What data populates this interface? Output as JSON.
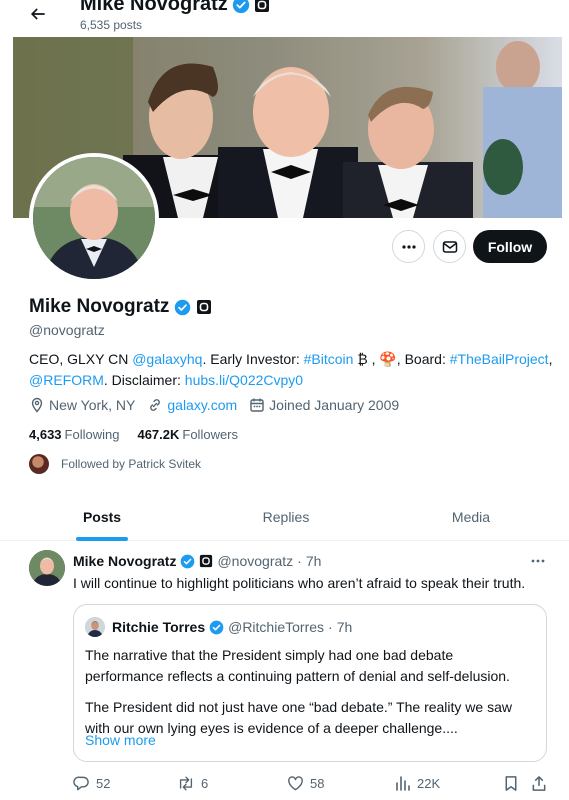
{
  "header": {
    "name": "Mike Novogratz",
    "posts_count": "6,535 posts"
  },
  "profile": {
    "name": "Mike Novogratz",
    "handle": "@novogratz",
    "bio": [
      {
        "text": "CEO, GLXY CN ",
        "link": false
      },
      {
        "text": "@galaxyhq",
        "link": true
      },
      {
        "text": ". Early Investor: ",
        "link": false
      },
      {
        "text": "#Bitcoin",
        "link": true
      },
      {
        "text": " ₿ , 🍄, Board: ",
        "link": false
      },
      {
        "text": "#TheBailProject",
        "link": true
      },
      {
        "text": ", ",
        "link": false
      },
      {
        "text": "@REFORM",
        "link": true
      },
      {
        "text": ". Disclaimer: ",
        "link": false
      },
      {
        "text": "hubs.li/Q022Cvpy0",
        "link": true
      }
    ],
    "location": "New York, NY",
    "website": "galaxy.com",
    "joined": "Joined January 2009",
    "following_count": "4,633",
    "following_label": "Following",
    "followers_count": "467.2K",
    "followers_label": "Followers",
    "followed_by": "Followed by Patrick Svitek",
    "follow_label": "Follow"
  },
  "tabs": [
    {
      "label": "Posts",
      "active": true
    },
    {
      "label": "Replies",
      "active": false
    },
    {
      "label": "Media",
      "active": false
    }
  ],
  "tweet": {
    "name": "Mike Novogratz",
    "handle": "@novogratz",
    "sep": "·",
    "time": "7h",
    "text": "I will continue to highlight politicians who aren’t afraid to speak their truth.",
    "quote": {
      "name": "Ritchie Torres",
      "handle": "@RitchieTorres",
      "sep": "·",
      "time": "7h",
      "paragraph1": "The narrative that the President simply had one bad debate performance reflects a continuing pattern of denial and self-delusion.",
      "paragraph2": "The President did not just have one “bad debate.” The reality we saw with our own lying eyes is evidence of a deeper challenge....",
      "show_more": "Show more"
    },
    "actions": {
      "replies": "52",
      "reposts": "6",
      "likes": "58",
      "views": "22K"
    }
  },
  "colors": {
    "accent": "#1d9bf0",
    "text": "#0f1419",
    "muted": "#536471",
    "follow_button": "#0f1419"
  },
  "icons": [
    "back-arrow-icon",
    "verified-badge-icon",
    "affiliate-badge-icon",
    "more-icon",
    "message-icon",
    "location-icon",
    "link-icon",
    "calendar-icon",
    "reply-icon",
    "repost-icon",
    "like-icon",
    "views-icon",
    "bookmark-icon",
    "share-icon"
  ]
}
